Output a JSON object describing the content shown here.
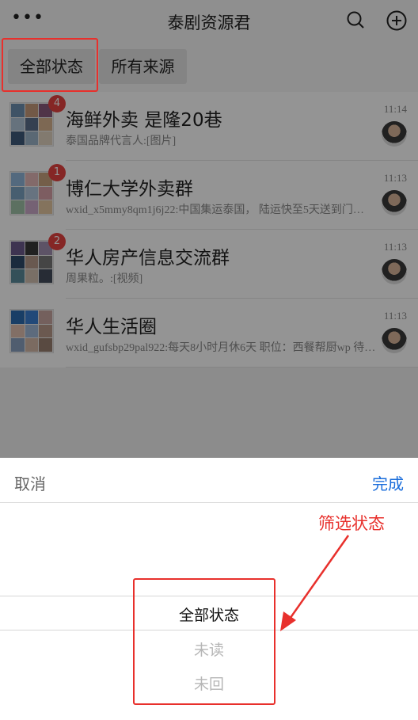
{
  "header": {
    "more_icon": "more-dots-icon",
    "title": "泰剧资源君",
    "search_icon": "search-icon",
    "add_icon": "plus-circle-icon"
  },
  "filters": {
    "all_status": "全部状态",
    "all_sources": "所有来源"
  },
  "chats": [
    {
      "name": "海鲜外卖 是隆20巷",
      "preview": "泰国品牌代言人:[图片]",
      "time": "11:14",
      "badge": "4",
      "colors": [
        "#6d8fb0",
        "#c49a7a",
        "#8a5a7c",
        "#b0c4d8",
        "#5b6f8c",
        "#d7b48f",
        "#3f5a7a",
        "#9bb3c9",
        "#e0d2c0"
      ]
    },
    {
      "name": "博仁大学外卖群",
      "preview": "wxid_x5mmy8qm1j6j22:中国集运泰国， 陆运快至5天送到门…",
      "time": "11:13",
      "badge": "1",
      "colors": [
        "#8fb6d9",
        "#e2b7b7",
        "#c9a27e",
        "#7aa3c2",
        "#b2c7dd",
        "#d8a0a8",
        "#9fc1a8",
        "#caa9c9",
        "#e4c6a0"
      ]
    },
    {
      "name": "华人房产信息交流群",
      "preview": "周果粒。:[视频]",
      "time": "11:13",
      "badge": "2",
      "colors": [
        "#6b5b8c",
        "#3a3a3a",
        "#a08fb0",
        "#2f4a6a",
        "#b59a8a",
        "#777777",
        "#5a8a9a",
        "#d0c0b0",
        "#444c5c"
      ]
    },
    {
      "name": "华人生活圈",
      "preview": "wxid_gufsbp29pal922:每天8小时月休6天 职位：西餐帮厨wp 待…",
      "time": "11:13",
      "badge": "",
      "colors": [
        "#2b6cb0",
        "#3b7fd0",
        "#c8a6a0",
        "#e0c0b0",
        "#a0b8d8",
        "#b89a8a",
        "#8aa0c0",
        "#d4b8a8",
        "#9a8070"
      ]
    }
  ],
  "sheet": {
    "cancel": "取消",
    "done": "完成",
    "options": [
      "全部状态",
      "未读",
      "未回"
    ],
    "selected_index": 0
  },
  "annotation": {
    "label": "筛选状态",
    "color": "#e8302c"
  }
}
